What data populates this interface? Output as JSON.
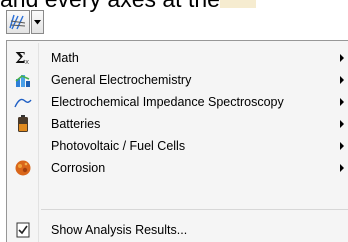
{
  "background": {
    "text": "and every axes    at the",
    "highlight_color": "#f6ecd0"
  },
  "toolbar": {
    "plot_button_icon": "plot-lines-icon",
    "dropdown_icon": "chevron-down-icon"
  },
  "menu": {
    "items": [
      {
        "label": "Math",
        "icon": "sigma-icon",
        "submenu": true
      },
      {
        "label": "General Electrochemistry",
        "icon": "bar-chart-icon",
        "submenu": true
      },
      {
        "label": "Electrochemical Impedance Spectroscopy",
        "icon": "arc-curve-icon",
        "submenu": true
      },
      {
        "label": "Batteries",
        "icon": "battery-icon",
        "submenu": true
      },
      {
        "label": "Photovoltaic / Fuel Cells",
        "icon": "",
        "submenu": true
      },
      {
        "label": "Corrosion",
        "icon": "corrosion-icon",
        "submenu": true
      },
      {
        "label": "Show Analysis Results...",
        "icon": "results-checklist-icon",
        "submenu": false
      }
    ]
  }
}
